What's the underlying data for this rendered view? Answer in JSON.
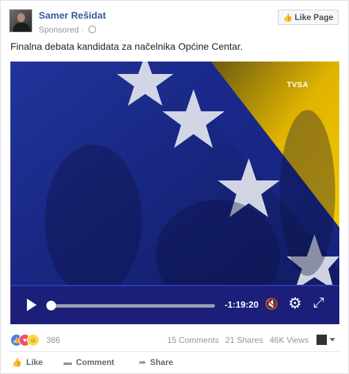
{
  "post": {
    "author": "Samer Rešidat",
    "sponsored_label": "Sponsored",
    "like_page_label": "Like Page",
    "message": "Finalna debata kandidata za načelnika Općine Centar."
  },
  "video": {
    "channel_logo": "TVSA",
    "remaining_time": "-1:19:20",
    "progress_fraction": 0.0
  },
  "engagement": {
    "reaction_count": "386",
    "comments": "15 Comments",
    "shares": "21 Shares",
    "views": "46K Views"
  },
  "actions": {
    "like": "Like",
    "comment": "Comment",
    "share": "Share"
  },
  "colors": {
    "author_link": "#365899",
    "player_bar": "#1b1f7a",
    "flag_blue": "#1a2a8c",
    "flag_yellow": "#f2c200"
  },
  "icons": {
    "play": "play-icon",
    "mute": "mute-icon",
    "settings": "gear-icon",
    "fullscreen": "expand-icon",
    "globe": "globe-icon",
    "thumb": "thumbs-up-icon"
  }
}
